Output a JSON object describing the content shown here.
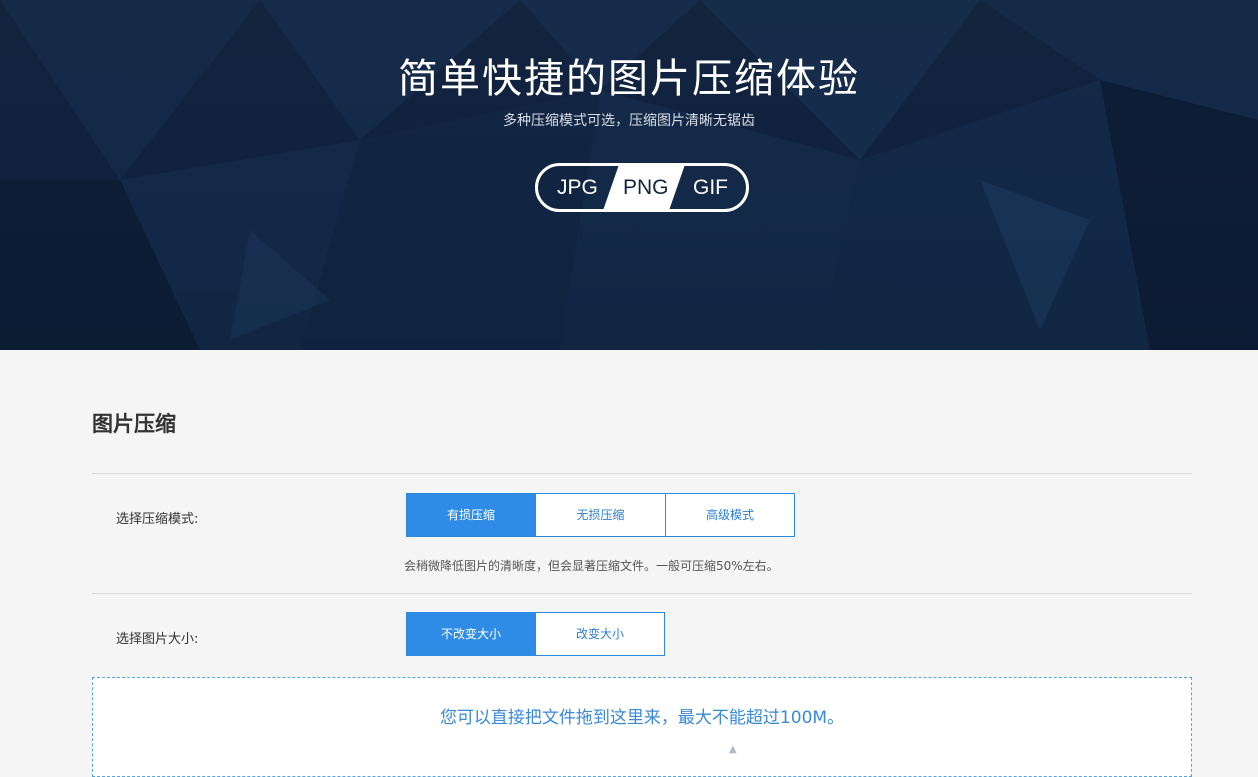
{
  "hero": {
    "title": "简单快捷的图片压缩体验",
    "subtitle": "多种压缩模式可选，压缩图片清晰无锯齿",
    "formats": [
      "JPG",
      "PNG",
      "GIF"
    ],
    "colors": {
      "background": "#0f2140",
      "pill_fill": "#ffffff"
    }
  },
  "panel": {
    "section_title": "图片压缩",
    "mode": {
      "label": "选择压缩模式:",
      "options": [
        "有损压缩",
        "无损压缩",
        "高级模式"
      ],
      "selected": "有损压缩",
      "description": "会稍微降低图片的清晰度，但会显著压缩文件。一般可压缩50%左右。"
    },
    "size": {
      "label": "选择图片大小:",
      "options": [
        "不改变大小",
        "改变大小"
      ],
      "selected": "不改变大小"
    },
    "dropzone": {
      "text": "您可以直接把文件拖到这里来，最大不能超过100M。",
      "icon": "upload-arrow-icon"
    },
    "colors": {
      "accent": "#2f8ce6",
      "accent_text": "#2d7fcf",
      "dropzone_border": "#5aa2e0"
    }
  }
}
